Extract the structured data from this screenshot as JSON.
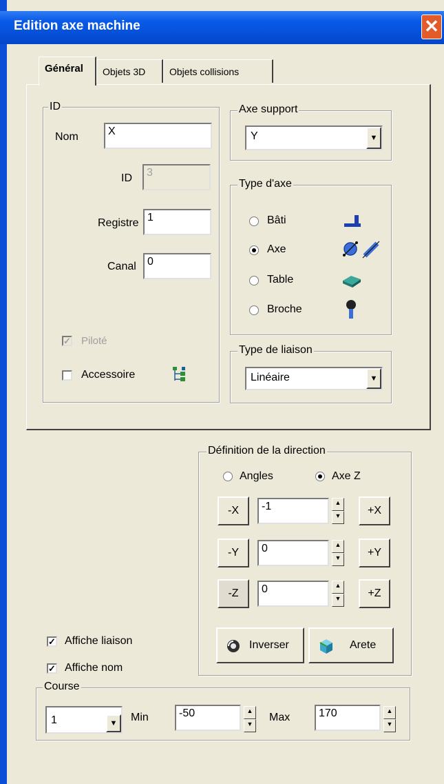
{
  "window": {
    "title": "Edition axe machine",
    "close_glyph": "✕"
  },
  "tabs": [
    {
      "label": "Général"
    },
    {
      "label": "Objets 3D"
    },
    {
      "label": "Objets collisions"
    }
  ],
  "id_group": {
    "title": "ID",
    "nom_label": "Nom",
    "nom_value": "X",
    "id_label": "ID",
    "id_value": "3",
    "registre_label": "Registre",
    "registre_value": "1",
    "canal_label": "Canal",
    "canal_value": "0",
    "pilote_label": "Piloté",
    "accessoire_label": "Accessoire",
    "check_glyph": "✓"
  },
  "axe_support": {
    "title": "Axe support",
    "value": "Y"
  },
  "type_axe": {
    "title": "Type d'axe",
    "options": [
      {
        "label": "Bâti",
        "icon": "bati-icon"
      },
      {
        "label": "Axe",
        "icon": "axe-icon"
      },
      {
        "label": "Table",
        "icon": "table-icon"
      },
      {
        "label": "Broche",
        "icon": "broche-icon"
      }
    ],
    "selected": "Axe"
  },
  "type_liaison": {
    "title": "Type de liaison",
    "value": "Linéaire"
  },
  "direction": {
    "title": "Définition de la direction",
    "angles_label": "Angles",
    "axez_label": "Axe Z",
    "rows": [
      {
        "minus": "-X",
        "value": "-1",
        "plus": "+X"
      },
      {
        "minus": "-Y",
        "value": "0",
        "plus": "+Y"
      },
      {
        "minus": "-Z",
        "value": "0",
        "plus": "+Z"
      }
    ],
    "inverser_label": "Inverser",
    "arete_label": "Arete"
  },
  "affiche_liaison_label": "Affiche liaison",
  "affiche_nom_label": "Affiche nom",
  "course": {
    "title": "Course",
    "select_value": "1",
    "min_label": "Min",
    "min_value": "-50",
    "max_label": "Max",
    "max_value": "170"
  },
  "glyphs": {
    "arrow_down": "▼",
    "arrow_up": "▲"
  },
  "colors": {
    "title_bar": "#0550d8",
    "window_bg": "#ece9d8",
    "close": "#e35a2b"
  }
}
